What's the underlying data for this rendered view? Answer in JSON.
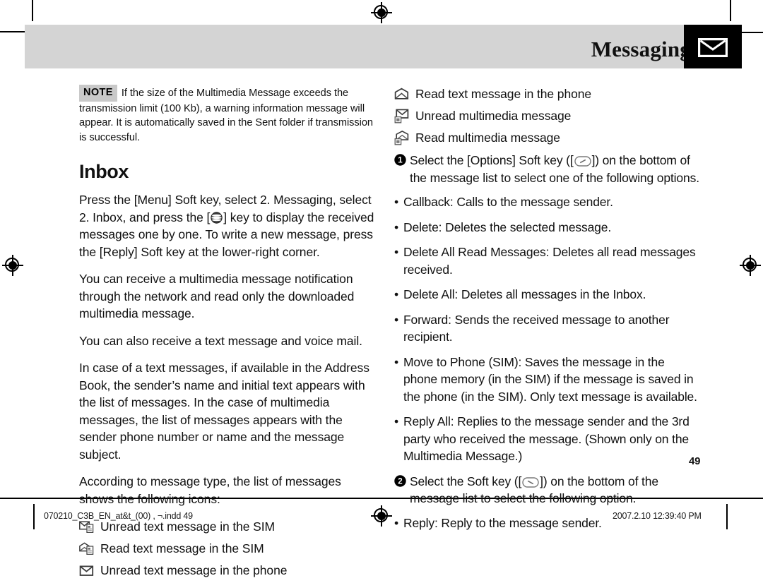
{
  "header": {
    "title": "Messaging",
    "badge_icon": "envelope-icon"
  },
  "page_number": "49",
  "note": {
    "badge": "NOTE",
    "text": "If the size of the Multimedia Message exceeds the transmission limit (100 Kb), a warning information message will appear. It is automatically saved in the Sent folder if transmission is successful."
  },
  "left_column": {
    "section_title": "Inbox",
    "paragraphs": [
      "Press the [Menu] Soft key, select 2. Messaging, select 2. Inbox, and press the [",
      "You can receive a multimedia message notification through the network and read only the downloaded multimedia message.",
      "You can also receive a text message and voice mail.",
      "In case of a text messages, if available in the Address Book, the sender’s name and initial text appears with the list of messages. In the case of multimedia messages, the list of messages appears with the sender phone number or name and the message subject.",
      "According to message type, the list of messages shows the following icons:"
    ],
    "paragraph1_tail": "] key to display the received messages one by one. To write a new message, press the [Reply] Soft key at the lower-right corner.",
    "icon_list": [
      {
        "icon": "unread-text-sim-icon",
        "label": "Unread text message in the SIM"
      },
      {
        "icon": "read-text-sim-icon",
        "label": "Read text message in the SIM"
      },
      {
        "icon": "unread-text-phone-icon",
        "label": "Unread text message in the phone"
      }
    ]
  },
  "right_column": {
    "icon_list": [
      {
        "icon": "read-text-phone-icon",
        "label": "Read text message in the phone"
      },
      {
        "icon": "unread-multimedia-icon",
        "label": "Unread multimedia message"
      },
      {
        "icon": "read-multimedia-icon",
        "label": "Read multimedia message"
      }
    ],
    "step1": {
      "marker": "1",
      "text_before": "Select the [Options] Soft key ([",
      "text_after": "]) on the bottom of the message list to select one of the following options."
    },
    "options": [
      "Callback: Calls to the message sender.",
      "Delete: Deletes the selected message.",
      "Delete All Read Messages: Deletes all read messages received.",
      "Delete All: Deletes all messages in the Inbox.",
      "Forward: Sends the received message to another recipient.",
      "Move to Phone (SIM): Saves the message in the phone memory (in the SIM) if the message is saved in the phone (in the SIM). Only text message is available.",
      "Reply All: Replies to the message sender and the 3rd party who received the message. (Shown only on the Multimedia Message.)"
    ],
    "step2": {
      "marker": "2",
      "text_before": "Select the Soft key ([",
      "text_after": "]) on the bottom of the message list to select the following option."
    },
    "options2": [
      "Reply: Reply to the message sender."
    ]
  },
  "footer": {
    "filename": "070210_C3B_EN_at&t_(00) , ¬.indd   49",
    "timestamp": "2007.2.10   12:39:40 PM"
  },
  "colors": {
    "header_band": "#d4d4d4",
    "badge_background": "#000000",
    "note_badge": "#c9c9c9",
    "text": "#111111"
  }
}
